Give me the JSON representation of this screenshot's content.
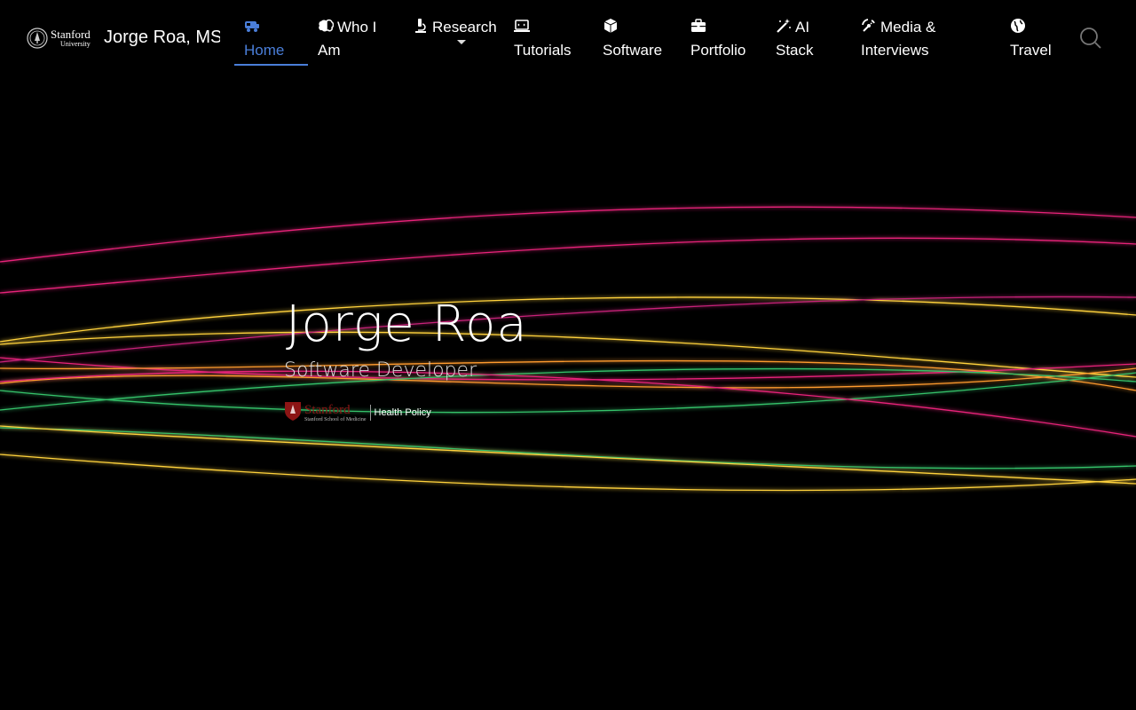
{
  "brand": {
    "university_line1": "Stanford",
    "university_line2": "University",
    "site_title": "Jorge Roa, MS"
  },
  "nav": [
    {
      "key": "home",
      "label": "Home",
      "icon": "camper-van-icon"
    },
    {
      "key": "who",
      "label": "Who I Am",
      "icon": "brain-icon"
    },
    {
      "key": "research",
      "label": "Research",
      "icon": "microscope-icon"
    },
    {
      "key": "tutorials",
      "label": "Tutorials",
      "icon": "laptop-code-icon"
    },
    {
      "key": "software",
      "label": "Software",
      "icon": "cube-icon"
    },
    {
      "key": "portfolio",
      "label": "Portfolio",
      "icon": "briefcase-icon"
    },
    {
      "key": "ai",
      "label": "AI Stack",
      "icon": "magic-wand-icon"
    },
    {
      "key": "media",
      "label": "Media & Interviews",
      "icon": "broadcast-icon"
    },
    {
      "key": "travel",
      "label": "Travel",
      "icon": "globe-icon"
    }
  ],
  "hero": {
    "name": "Jorge Roa",
    "subtitle": "Software Developer",
    "org_logo": {
      "stanford": "Stanford",
      "school": "Stanford School of Medicine",
      "dept": "Health Policy"
    }
  },
  "colors": {
    "active": "#4a7ed9",
    "wave_pink": "#e8247a",
    "wave_yellow": "#ffd23c",
    "wave_orange": "#ff9b2e",
    "wave_green": "#34c26a",
    "stanford_red": "#8c1515"
  }
}
